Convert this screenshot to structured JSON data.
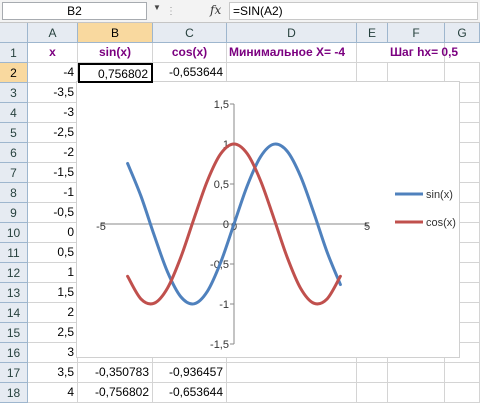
{
  "formula_bar": {
    "name_box": "B2",
    "fx_label": "fx",
    "formula": "=SIN(A2)"
  },
  "columns": [
    "A",
    "B",
    "C",
    "D",
    "E",
    "F",
    "G"
  ],
  "rows": [
    {
      "row": "1",
      "a": "x",
      "b": "sin(x)",
      "c": "cos(x)",
      "d": "Минимальное X= -4",
      "f": "Шаг hx= 0,5"
    },
    {
      "row": "2",
      "a": "-4",
      "b": "0,756802",
      "c": "-0,653644"
    },
    {
      "row": "3",
      "a": "-3,5"
    },
    {
      "row": "4",
      "a": "-3"
    },
    {
      "row": "5",
      "a": "-2,5"
    },
    {
      "row": "6",
      "a": "-2"
    },
    {
      "row": "7",
      "a": "-1,5"
    },
    {
      "row": "8",
      "a": "-1"
    },
    {
      "row": "9",
      "a": "-0,5"
    },
    {
      "row": "10",
      "a": "0"
    },
    {
      "row": "11",
      "a": "0,5"
    },
    {
      "row": "12",
      "a": "1"
    },
    {
      "row": "13",
      "a": "1,5"
    },
    {
      "row": "14",
      "a": "2"
    },
    {
      "row": "15",
      "a": "2,5"
    },
    {
      "row": "16",
      "a": "3"
    },
    {
      "row": "17",
      "a": "3,5",
      "b": "-0,350783",
      "c": "-0,936457"
    },
    {
      "row": "18",
      "a": "4",
      "b": "-0,756802",
      "c": "-0,653644"
    }
  ],
  "selected": {
    "column": "B",
    "row": "2"
  },
  "colors": {
    "header_text": "#7b0080",
    "sin": "#4f81bd",
    "cos": "#c0504d"
  },
  "chart_data": {
    "type": "scatter",
    "title": "",
    "xlabel": "",
    "ylabel": "",
    "xlim": [
      -5,
      5
    ],
    "ylim": [
      -1.5,
      1.5
    ],
    "x_ticks": [
      "-5",
      "0",
      "5"
    ],
    "y_ticks": [
      "1,5",
      "1",
      "0,5",
      "0",
      "-0,5",
      "-1",
      "-1,5"
    ],
    "legend_position": "right",
    "smooth": true,
    "x": [
      -4,
      -3.5,
      -3,
      -2.5,
      -2,
      -1.5,
      -1,
      -0.5,
      0,
      0.5,
      1,
      1.5,
      2,
      2.5,
      3,
      3.5,
      4
    ],
    "series": [
      {
        "name": "sin(x)",
        "color": "#4f81bd",
        "values": [
          0.7568,
          0.3508,
          -0.1411,
          -0.5985,
          -0.9093,
          -0.9975,
          -0.8415,
          -0.4794,
          0,
          0.4794,
          0.8415,
          0.9975,
          0.9093,
          0.5985,
          0.1411,
          -0.3508,
          -0.7568
        ]
      },
      {
        "name": "cos(x)",
        "color": "#c0504d",
        "values": [
          -0.6536,
          -0.9365,
          -0.99,
          -0.8011,
          -0.4161,
          0.0707,
          0.5403,
          0.8776,
          1,
          0.8776,
          0.5403,
          0.0707,
          -0.4161,
          -0.8011,
          -0.99,
          -0.9365,
          -0.6536
        ]
      }
    ]
  }
}
